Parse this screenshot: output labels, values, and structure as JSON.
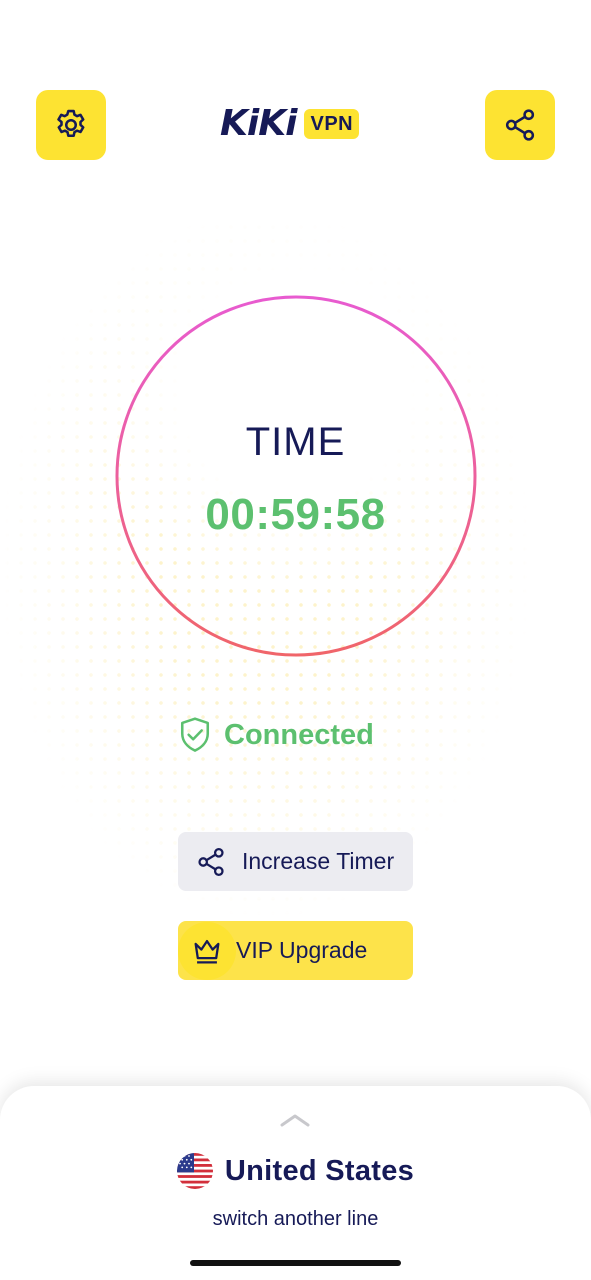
{
  "header": {
    "settings_icon": "gear-icon",
    "share_icon": "share-icon",
    "logo_word": "KiKi",
    "logo_badge": "VPN"
  },
  "timer": {
    "label": "TIME",
    "value": "00:59:58"
  },
  "status": {
    "icon": "shield-check-icon",
    "text": "Connected"
  },
  "actions": {
    "increase_timer_label": "Increase Timer",
    "vip_upgrade_label": "VIP Upgrade"
  },
  "location": {
    "country": "United States",
    "switch_label": "switch another line",
    "flag_icon": "us-flag-icon"
  },
  "colors": {
    "accent_yellow": "#fde332",
    "navy": "#161a57",
    "connected_green": "#5cc06f",
    "ring_pink": "#e85bd0",
    "ring_red": "#f0656a"
  }
}
